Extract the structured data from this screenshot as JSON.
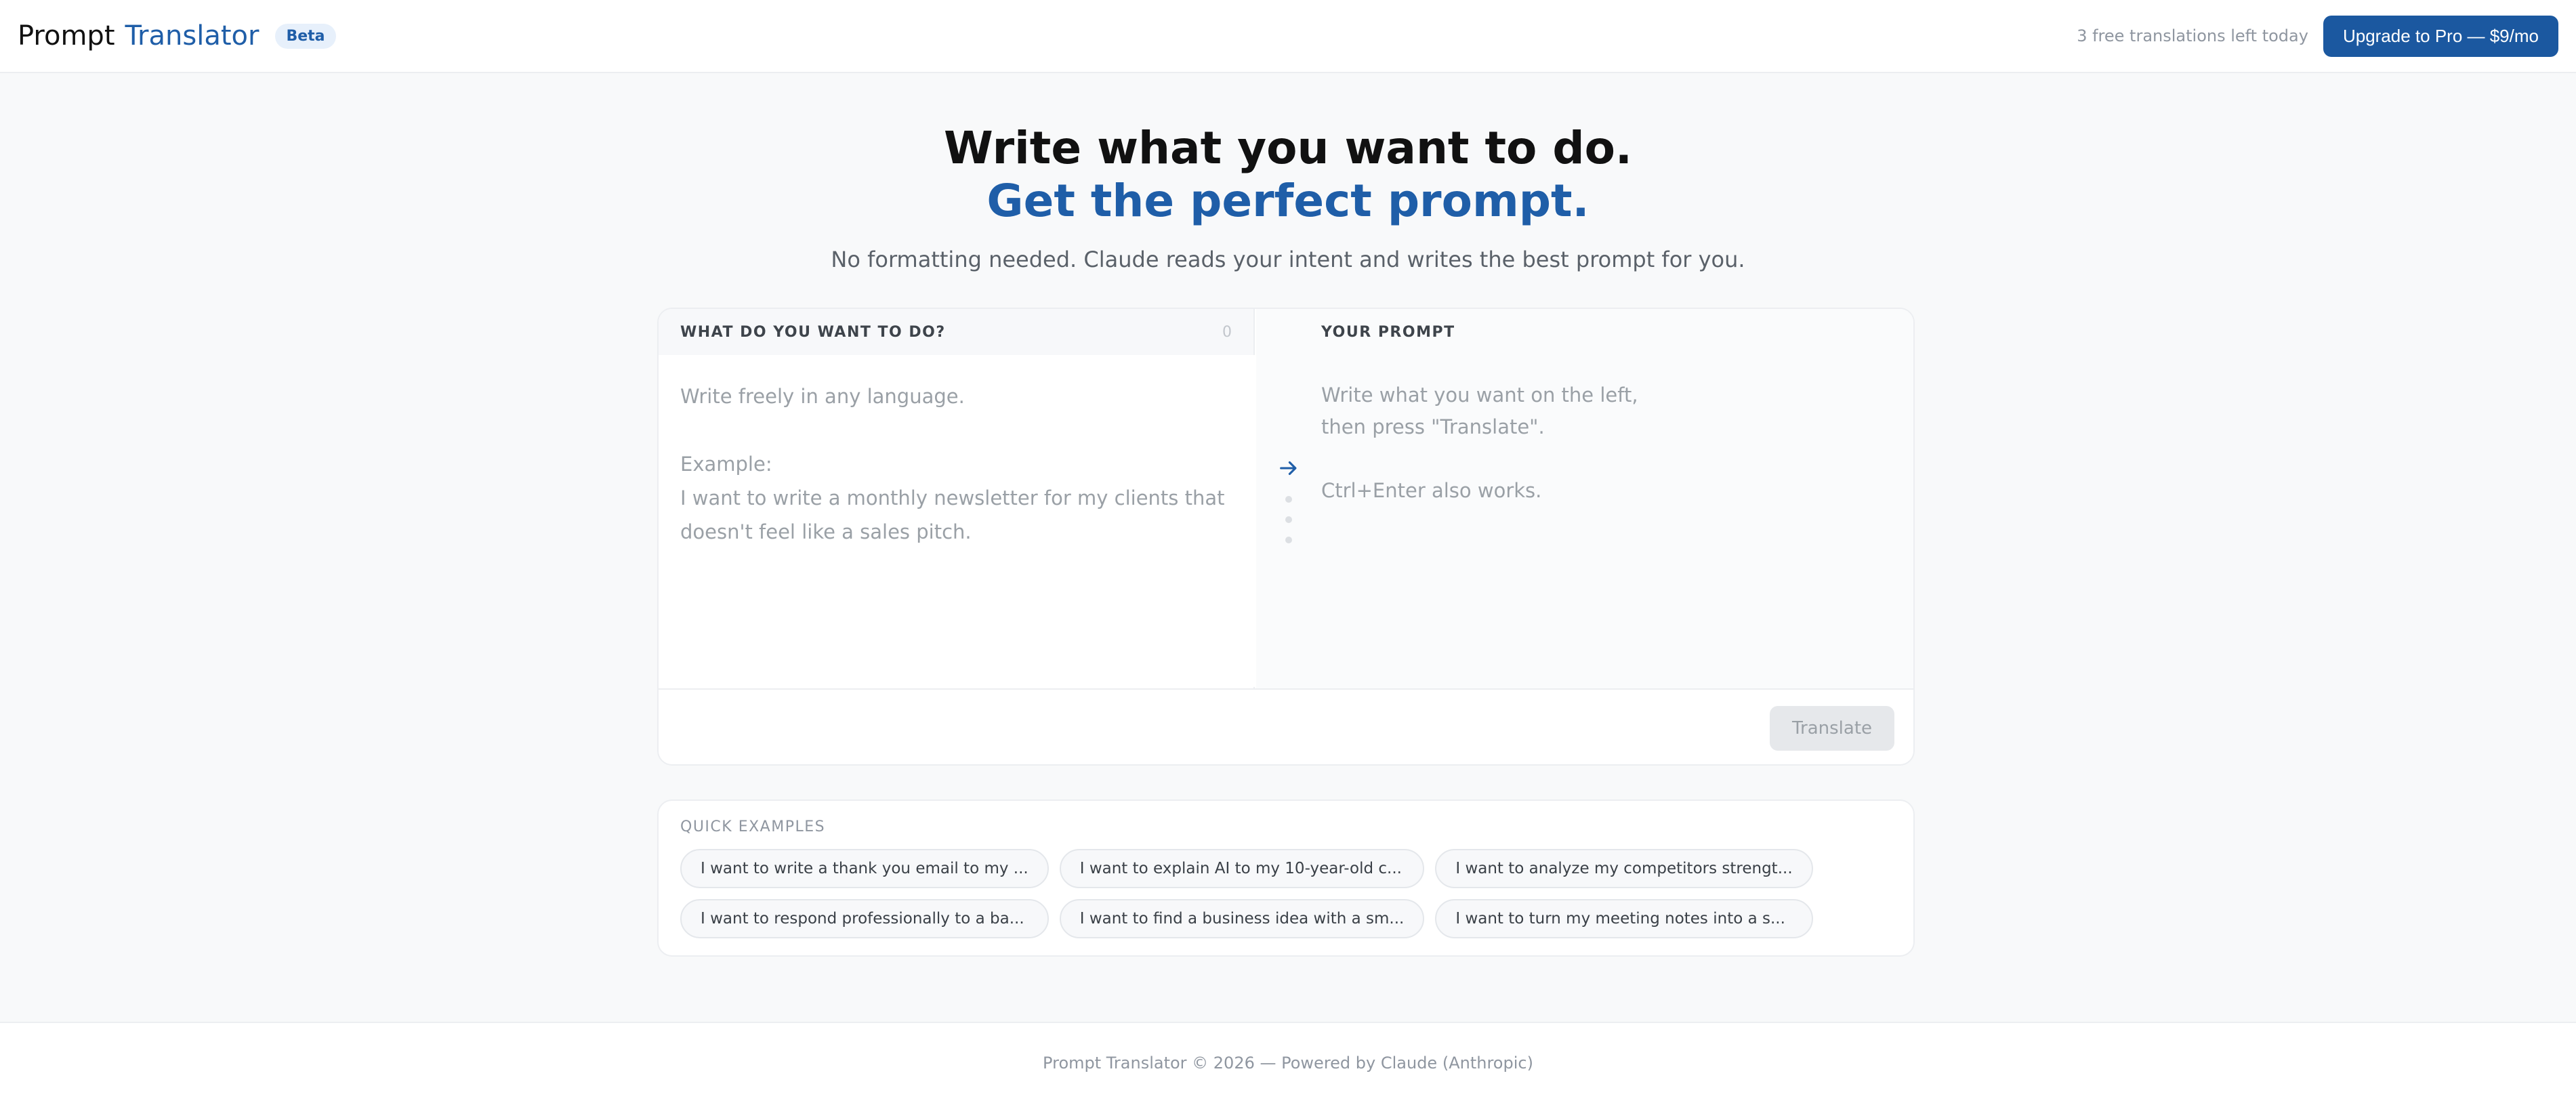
{
  "header": {
    "brand_part1": "Prompt",
    "brand_part2": "Translator",
    "badge": "Beta",
    "quota_text": "3 free translations left today",
    "upgrade_label": "Upgrade to Pro — $9/mo"
  },
  "hero": {
    "title_line1": "Write what you want to do.",
    "title_line2": "Get the perfect prompt.",
    "subtitle": "No formatting needed. Claude reads your intent and writes the best prompt for you."
  },
  "input_panel": {
    "label": "WHAT DO YOU WANT TO DO?",
    "char_count": "0",
    "placeholder": "Write freely in any language.\n\nExample:\nI want to write a monthly newsletter for my clients that doesn't feel like a sales pitch.",
    "value": ""
  },
  "output_panel": {
    "label": "YOUR PROMPT",
    "placeholder": "Write what you want on the left,\nthen press \"Translate\".\n\nCtrl+Enter also works."
  },
  "actions": {
    "translate_label": "Translate"
  },
  "quick_examples": {
    "label": "QUICK EXAMPLES",
    "items": [
      "I want to write a thank you email to my ...",
      "I want to explain AI to my 10-year-old c...",
      "I want to analyze my competitors strengt...",
      "I want to respond professionally to a ba...",
      "I want to find a business idea with a sm...",
      "I want to turn my meeting notes into a s..."
    ]
  },
  "footer": {
    "text": "Prompt Translator © 2026 — Powered by Claude (Anthropic)"
  },
  "colors": {
    "accent": "#1f5ea8",
    "button_primary": "#1b58a0",
    "page_background": "#f8f9fa",
    "muted_text": "#8f96a0"
  },
  "icons": {
    "arrow": "arrow-right-icon"
  }
}
